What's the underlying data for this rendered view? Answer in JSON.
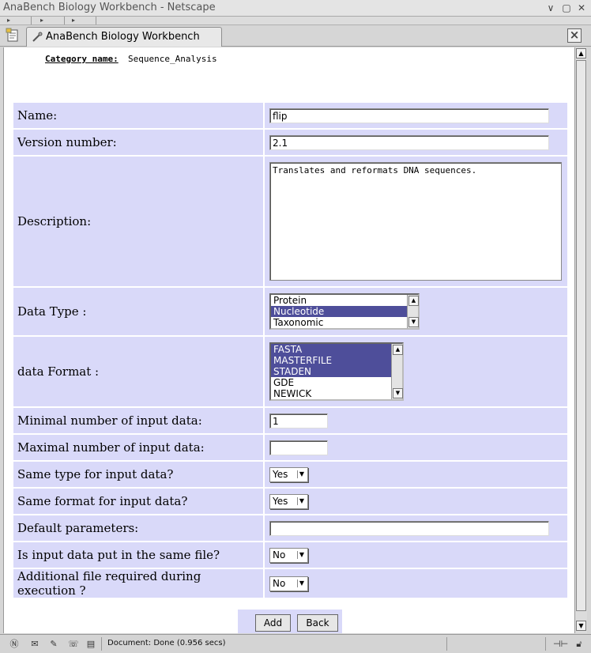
{
  "window": {
    "title": "AnaBench Biology Workbench - Netscape",
    "controls": [
      "∨",
      "▢",
      "✕"
    ]
  },
  "tab": {
    "label": "AnaBench Biology Workbench"
  },
  "category": {
    "label": "Category name:",
    "value": "Sequence_Analysis"
  },
  "form": {
    "name": {
      "label": "Name:",
      "value": "flip"
    },
    "version": {
      "label": "Version number:",
      "value": "2.1"
    },
    "description": {
      "label": "Description:",
      "value": "Translates and reformats DNA sequences."
    },
    "data_type": {
      "label": "Data Type :",
      "options": [
        {
          "text": "Protein",
          "selected": false
        },
        {
          "text": "Nucleotide",
          "selected": true
        },
        {
          "text": "Taxonomic",
          "selected": false
        }
      ]
    },
    "data_format": {
      "label": "data Format :",
      "options": [
        {
          "text": "FASTA",
          "selected": true
        },
        {
          "text": "MASTERFILE",
          "selected": true
        },
        {
          "text": "STADEN",
          "selected": true
        },
        {
          "text": "GDE",
          "selected": false
        },
        {
          "text": "NEWICK",
          "selected": false
        }
      ]
    },
    "min_input": {
      "label": "Minimal number of input data:",
      "value": "1"
    },
    "max_input": {
      "label": "Maximal number of input data:",
      "value": ""
    },
    "same_type": {
      "label": "Same type for input data?",
      "value": "Yes"
    },
    "same_format": {
      "label": "Same format for input data?",
      "value": "Yes"
    },
    "default_params": {
      "label": "Default parameters:",
      "value": ""
    },
    "same_file": {
      "label": "Is input data put in the same file?",
      "value": "No"
    },
    "additional_file": {
      "label": "Additional file required during execution ?",
      "value": "No"
    }
  },
  "buttons": {
    "add": "Add",
    "back": "Back"
  },
  "status": {
    "text": "Document: Done (0.956 secs)"
  },
  "colors": {
    "row_bg": "#d9d9f9",
    "selection": "#4e4e9a"
  }
}
